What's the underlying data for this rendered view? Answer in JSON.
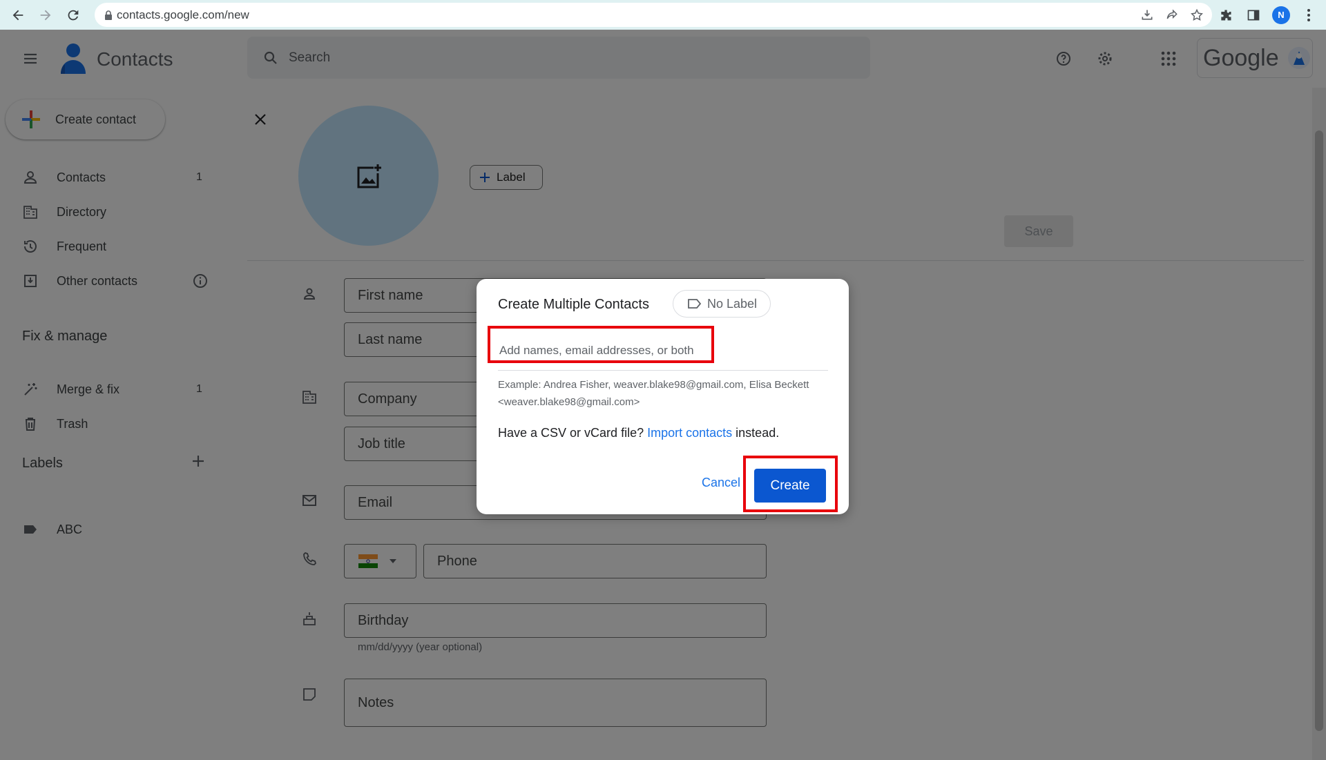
{
  "browser": {
    "url": "contacts.google.com/new",
    "profile_initial": "N"
  },
  "header": {
    "app_title": "Contacts",
    "search_placeholder": "Search",
    "brand": "Google"
  },
  "sidebar": {
    "create_label": "Create contact",
    "items": [
      {
        "label": "Contacts",
        "count": "1",
        "icon": "person-icon"
      },
      {
        "label": "Directory",
        "count": "",
        "icon": "building-icon"
      },
      {
        "label": "Frequent",
        "count": "",
        "icon": "history-icon"
      },
      {
        "label": "Other contacts",
        "count": "",
        "icon": "download-box-icon"
      }
    ],
    "fix_title": "Fix & manage",
    "fix_items": [
      {
        "label": "Merge & fix",
        "count": "1",
        "icon": "magic-wand-icon"
      },
      {
        "label": "Trash",
        "count": "",
        "icon": "trash-icon"
      }
    ],
    "labels_title": "Labels",
    "labels": [
      {
        "label": "ABC",
        "icon": "label-icon"
      }
    ]
  },
  "form": {
    "label_button": "Label",
    "save_label": "Save",
    "first_name": "First name",
    "last_name": "Last name",
    "company": "Company",
    "job_title": "Job title",
    "email": "Email",
    "phone": "Phone",
    "birthday": "Birthday",
    "birthday_hint": "mm/dd/yyyy (year optional)",
    "notes": "Notes"
  },
  "dialog": {
    "title": "Create Multiple Contacts",
    "label_chip": "No Label",
    "input_placeholder": "Add names, email addresses, or both",
    "example_line1": "Example: Andrea Fisher, weaver.blake98@gmail.com, Elisa Beckett",
    "example_line2": "<weaver.blake98@gmail.com>",
    "csv_prefix": "Have a CSV or vCard file?",
    "csv_link": "Import contacts",
    "csv_suffix": "instead.",
    "cancel_label": "Cancel",
    "create_label": "Create"
  },
  "colors": {
    "highlight": "#e8000b",
    "accent": "#1a73e8",
    "primary_button": "#0b57d0"
  }
}
